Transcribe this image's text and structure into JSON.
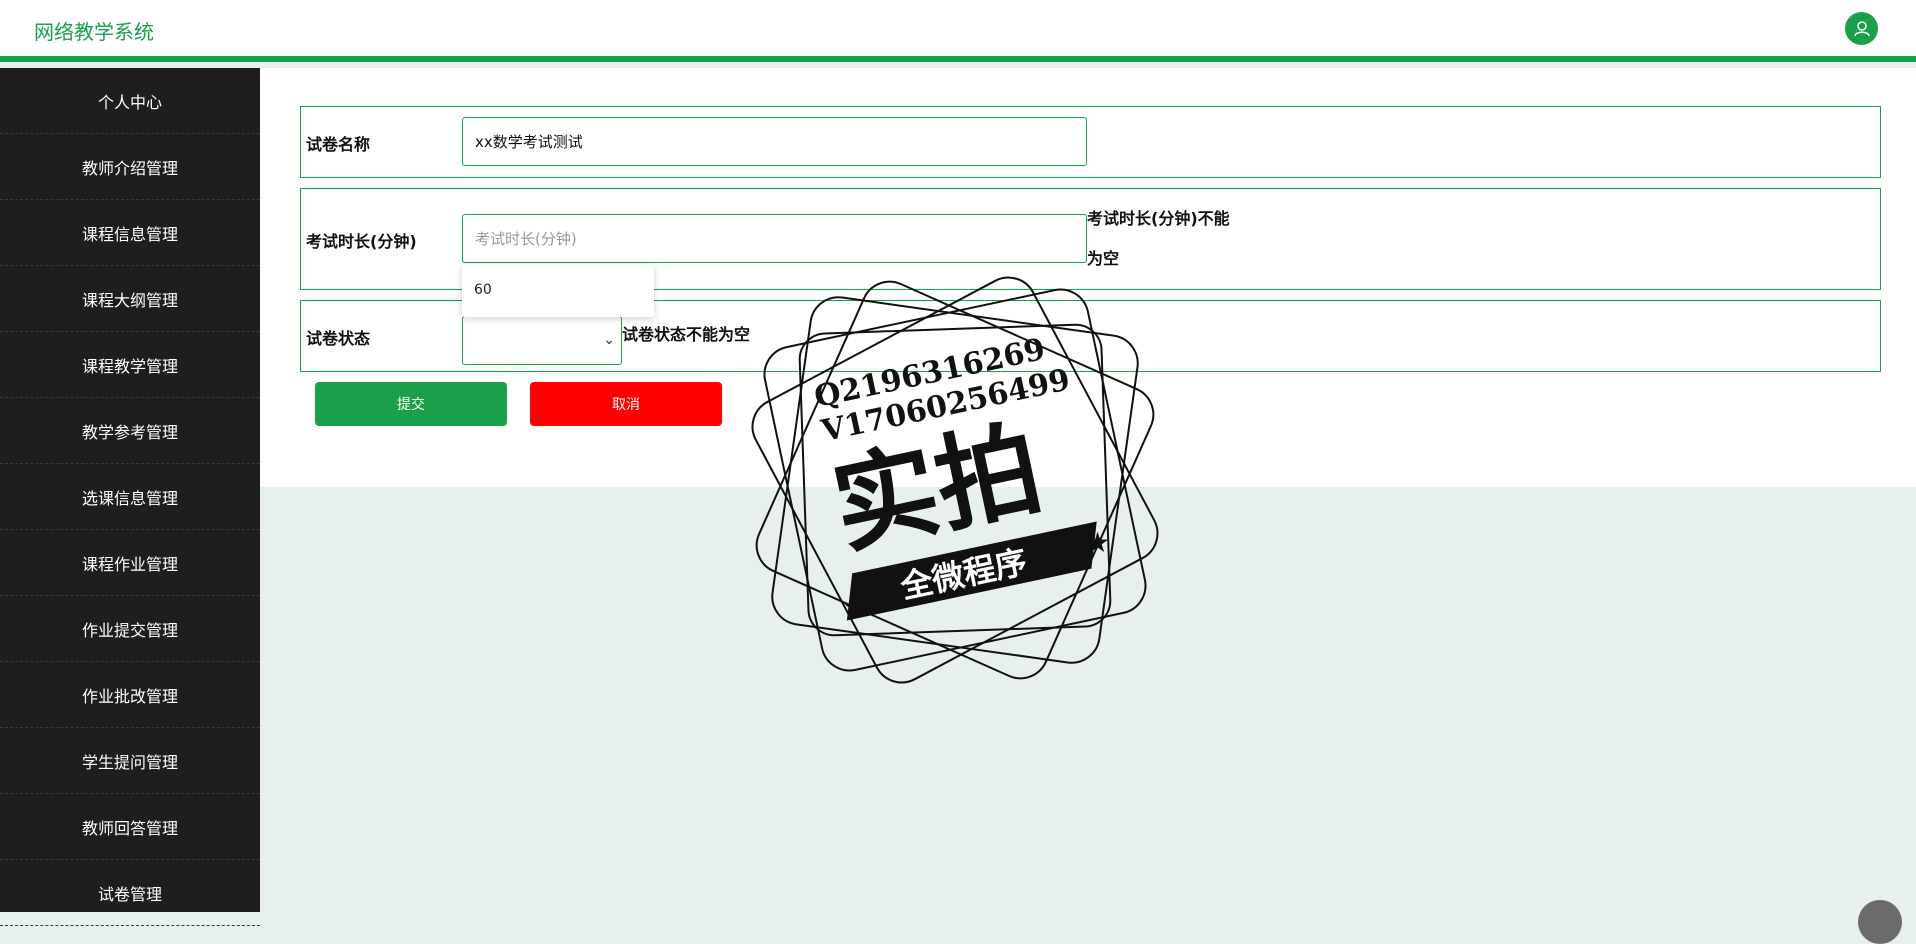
{
  "header": {
    "title": "网络教学系统",
    "avatar_icon": "user-icon",
    "accent": "#1aa04a"
  },
  "sidebar": {
    "items": [
      {
        "label": "个人中心"
      },
      {
        "label": "教师介绍管理"
      },
      {
        "label": "课程信息管理"
      },
      {
        "label": "课程大纲管理"
      },
      {
        "label": "课程教学管理"
      },
      {
        "label": "教学参考管理"
      },
      {
        "label": "选课信息管理"
      },
      {
        "label": "课程作业管理"
      },
      {
        "label": "作业提交管理"
      },
      {
        "label": "作业批改管理"
      },
      {
        "label": "学生提问管理"
      },
      {
        "label": "教师回答管理"
      },
      {
        "label": "试卷管理"
      }
    ]
  },
  "form": {
    "paper_name": {
      "label": "试卷名称",
      "value": "xx数学考试测试"
    },
    "duration": {
      "label": "考试时长(分钟)",
      "placeholder": "考试时长(分钟)",
      "error": "考试时长(分钟)不能为空",
      "suggestion": "60"
    },
    "status": {
      "label": "试卷状态",
      "error": "试卷状态不能为空"
    },
    "submit_label": "提交",
    "cancel_label": "取消"
  },
  "watermark": {
    "line1": "Q2196316269",
    "line2": "V17060256499",
    "main": "实拍",
    "banner": "全微程序"
  }
}
